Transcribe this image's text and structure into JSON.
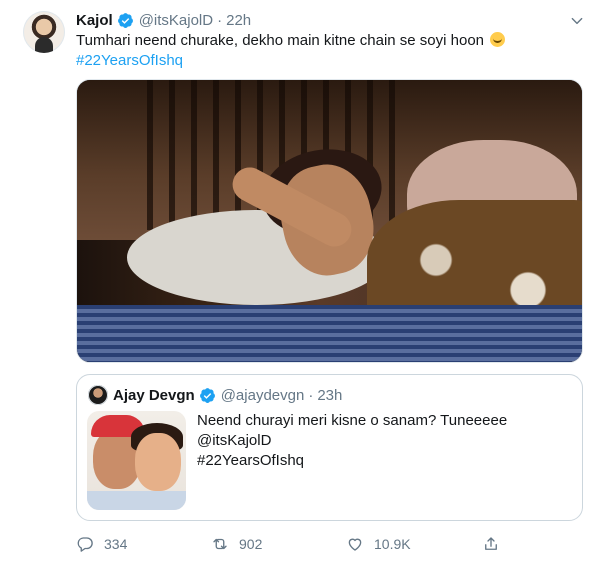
{
  "tweet": {
    "author_name": "Kajol",
    "author_handle": "@itsKajolD",
    "separator": "·",
    "time": "22h",
    "text_line1": "Tumhari neend churake, dekho main kitne chain se soyi hoon",
    "emoji_name": "face-with-tears-of-joy-icon",
    "hashtag": "#22YearsOfIshq"
  },
  "quoted_tweet": {
    "author_name": "Ajay Devgn",
    "author_handle": "@ajaydevgn",
    "separator": "·",
    "time": "23h",
    "line1": "Neend churayi meri kisne o sanam? Tuneeeee",
    "line2": "@itsKajolD",
    "line3": "#22YearsOfIshq"
  },
  "actions": {
    "reply_count": "334",
    "retweet_count": "902",
    "like_count": "10.9K"
  },
  "colors": {
    "link": "#1da1f2",
    "muted": "#657786",
    "text": "#14171a",
    "verified": "#1da1f2"
  }
}
